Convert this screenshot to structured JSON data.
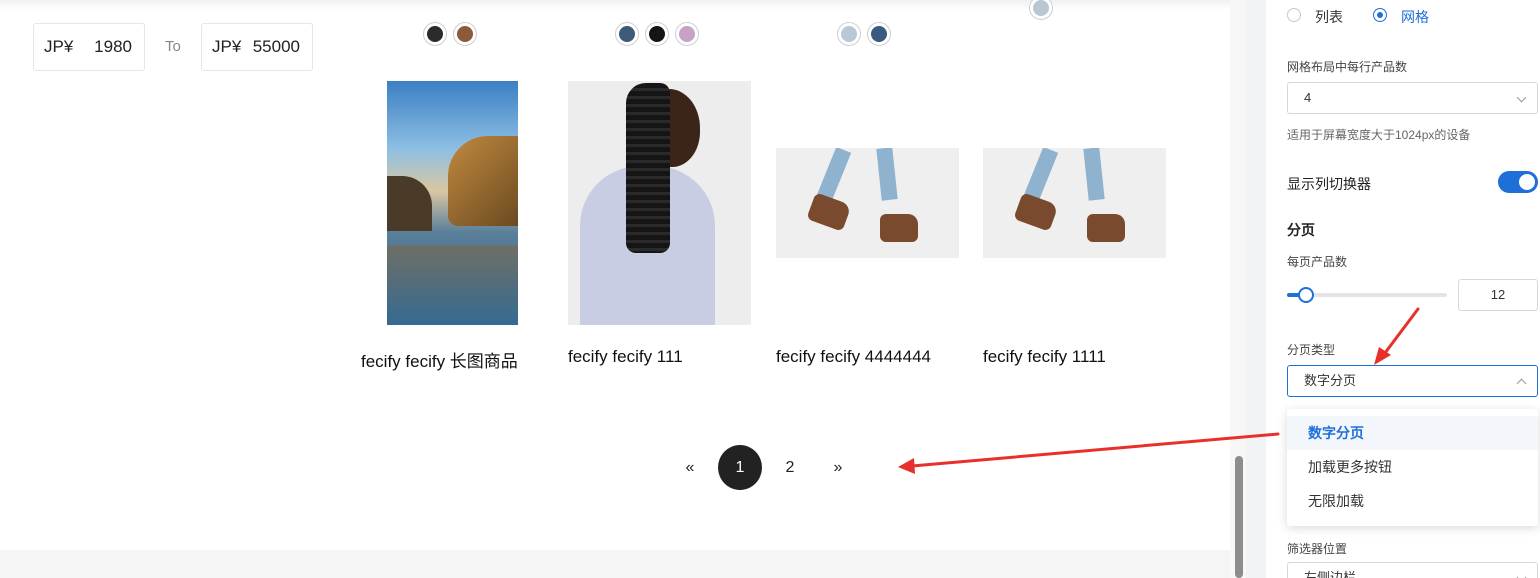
{
  "filter": {
    "price_min_currency": "JP¥",
    "price_min_value": "1980",
    "to_label": "To",
    "price_max_currency": "JP¥",
    "price_max_value": "55000"
  },
  "products": [
    {
      "title": "fecify fecify 长图商品"
    },
    {
      "title": "fecify fecify 111"
    },
    {
      "title": "fecify fecify 4444444"
    },
    {
      "title": "fecify fecify 1111"
    }
  ],
  "swatch_colors": [
    "#2b2b2b",
    "#8a5a3a",
    "#3e5a78",
    "#151515",
    "#c6a2c6",
    "#b8c8d8",
    "#3a5a80",
    "#b9c7d3"
  ],
  "pagination": {
    "prev": "«",
    "pages": [
      "1",
      "2"
    ],
    "current": "1",
    "next": "»"
  },
  "settings": {
    "layout_options": [
      "列表",
      "网格"
    ],
    "layout_selected": "网格",
    "products_per_row_label": "网格布局中每行产品数",
    "products_per_row_value": "4",
    "products_per_row_hint": "适用于屏幕宽度大于1024px的设备",
    "show_column_switcher_label": "显示列切换器",
    "show_column_switcher": true,
    "pagination_section": "分页",
    "per_page_label": "每页产品数",
    "per_page_value": "12",
    "per_page_slider_fraction": 0.07,
    "pagination_type_label": "分页类型",
    "pagination_type_value": "数字分页",
    "pagination_type_options": [
      "数字分页",
      "加载更多按钮",
      "无限加载"
    ],
    "filter_position_label": "筛选器位置",
    "filter_position_value": "左侧边栏"
  },
  "colors": {
    "accent": "#1f6fd9",
    "annotation": "#e8302a",
    "page_active": "#222222"
  }
}
